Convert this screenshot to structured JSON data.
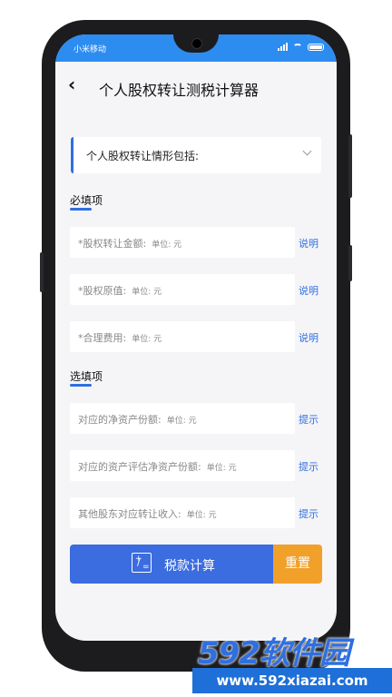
{
  "status_bar": {
    "carrier": "小米移动"
  },
  "header": {
    "back_icon": "‹",
    "title": "个人股权转让测税计算器"
  },
  "dropdown": {
    "label": "个人股权转让情形包括:"
  },
  "required_section": {
    "title": "必填项",
    "fields": [
      {
        "label": "*股权转让金额:",
        "unit": "单位: 元",
        "help": "说明"
      },
      {
        "label": "*股权原值:",
        "unit": "单位: 元",
        "help": "说明"
      },
      {
        "label": "*合理费用:",
        "unit": "单位: 元",
        "help": "说明"
      }
    ]
  },
  "optional_section": {
    "title": "选填项",
    "fields": [
      {
        "label": "对应的净资产份额:",
        "unit": "单位: 元",
        "help": "提示"
      },
      {
        "label": "对应的资产评估净资产份额:",
        "unit": "单位: 元",
        "help": "提示"
      },
      {
        "label": "其他股东对应转让收入:",
        "unit": "单位: 元",
        "help": "提示"
      }
    ]
  },
  "buttons": {
    "calculate": "税款计算",
    "reset": "重置",
    "calc_icon": "calculator-icon"
  },
  "watermark": {
    "brand": "592软件园",
    "url": "www.592xiazai.com"
  },
  "colors": {
    "primary": "#3b6ce0",
    "status_bar": "#2d8cf0",
    "reset": "#f1a02a"
  }
}
